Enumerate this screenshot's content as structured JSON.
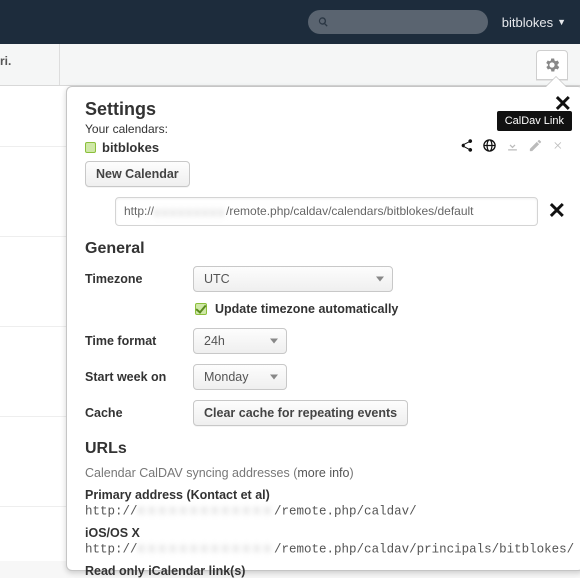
{
  "header": {
    "search_placeholder": "",
    "username": "bitblokes"
  },
  "subheader": {
    "day_label": "ri."
  },
  "panel": {
    "title": "Settings",
    "your_calendars_label": "Your calendars:",
    "tooltip": "CalDav Link",
    "calendar": {
      "name": "bitblokes"
    },
    "new_calendar_btn": "New Calendar",
    "caldav_url_prefix": "http://",
    "caldav_url_suffix": "/remote.php/caldav/calendars/bitblokes/default",
    "general": {
      "heading": "General",
      "timezone_label": "Timezone",
      "timezone_value": "UTC",
      "auto_tz_label": "Update timezone automatically",
      "timeformat_label": "Time format",
      "timeformat_value": "24h",
      "startweek_label": "Start week on",
      "startweek_value": "Monday",
      "cache_label": "Cache",
      "cache_btn": "Clear cache for repeating events"
    },
    "urls": {
      "heading": "URLs",
      "note_prefix": "Calendar CalDAV syncing addresses (",
      "note_link": "more info",
      "note_suffix": ")",
      "primary_label": "Primary address (Kontact et al)",
      "primary_prefix": "http://",
      "primary_suffix": "/remote.php/caldav/",
      "ios_label": "iOS/OS X",
      "ios_prefix": "http://",
      "ios_suffix": "/remote.php/caldav/principals/bitblokes/",
      "readonly_label": "Read only iCalendar link(s)"
    }
  }
}
